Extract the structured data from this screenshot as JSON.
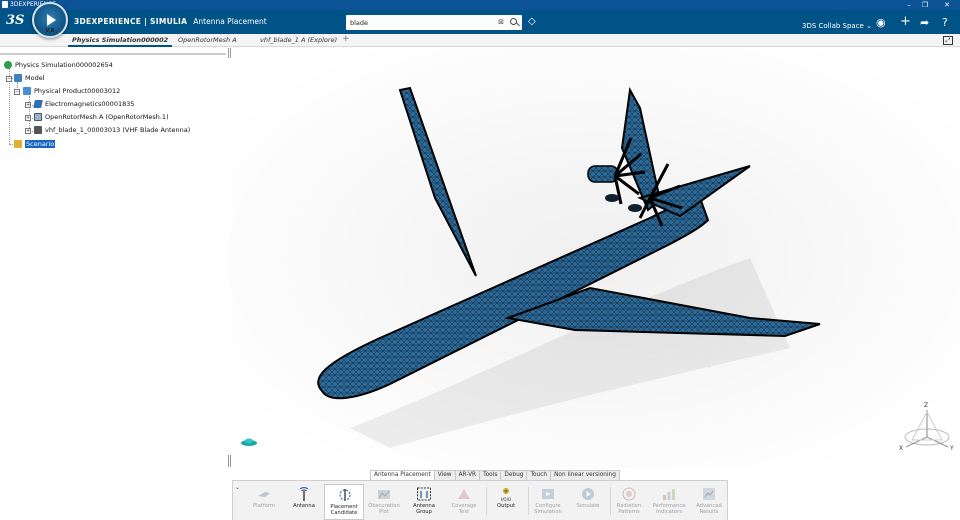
{
  "window": {
    "title": "3DEXPERIENCE"
  },
  "header": {
    "compass_label": "V,R",
    "brand_prefix": "3D",
    "brand_main": "EXPERIENCE | SIMULIA",
    "app_name": "Antenna Placement",
    "search_value": "blade",
    "collab_space": "3DS Collab Space",
    "accent": "#005386"
  },
  "tabs": [
    {
      "label": "Physics Simulation000002",
      "active": true
    },
    {
      "label": "OpenRotorMesh A",
      "active": false
    },
    {
      "label": "vhf_blade_1 A (Explore)",
      "active": false
    }
  ],
  "tree": {
    "root": "Physics Simulation000002654",
    "model": "Model",
    "product": "Physical Product00003012",
    "children": [
      "Electromagnetics00001835",
      "OpenRotorMesh A (OpenRotorMesh.1)",
      "vhf_blade_1_00003013 (VHF Blade Antenna)"
    ],
    "scenario": "Scenario"
  },
  "axes": {
    "x": "X",
    "y": "Y",
    "z": "Z"
  },
  "action_tabs": [
    "Antenna Placement",
    "View",
    "AR-VR",
    "Tools",
    "Debug",
    "Touch",
    "Non linear versioning"
  ],
  "commands": [
    {
      "line1": "Platform",
      "line2": "",
      "enabled": false
    },
    {
      "line1": "Antenna",
      "line2": "",
      "enabled": true
    },
    {
      "line1": "Placement",
      "line2": "Candidate",
      "enabled": true
    },
    {
      "line1": "Obscuration",
      "line2": "Plot",
      "enabled": false
    },
    {
      "line1": "Antenna",
      "line2": "Group",
      "enabled": true
    },
    {
      "line1": "Coverage",
      "line2": "Test",
      "enabled": false
    },
    {
      "line1": "Output",
      "line2": "",
      "enabled": true
    },
    {
      "line1": "Configure",
      "line2": "Simulation",
      "enabled": false
    },
    {
      "line1": "Simulate",
      "line2": "",
      "enabled": false
    },
    {
      "line1": "Radiation",
      "line2": "Patterns",
      "enabled": false
    },
    {
      "line1": "Performance",
      "line2": "Indicators",
      "enabled": false
    },
    {
      "line1": "Advanced",
      "line2": "Results",
      "enabled": false
    }
  ],
  "output_icon_text": "I/O/O"
}
